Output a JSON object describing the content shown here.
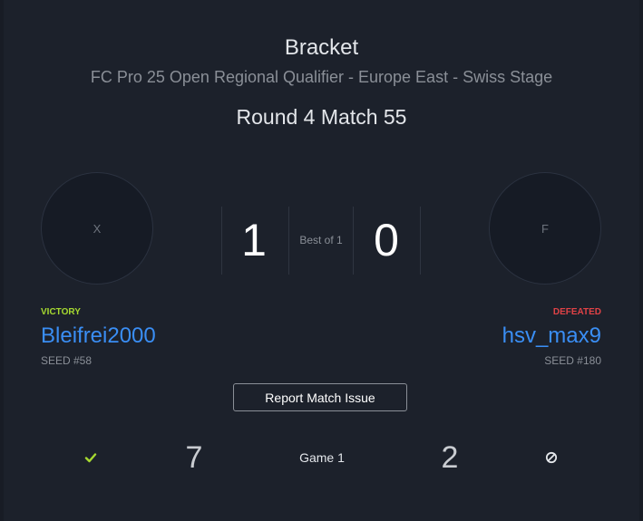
{
  "header": {
    "title": "Bracket",
    "subtitle": "FC Pro 25 Open Regional Qualifier - Europe East - Swiss Stage",
    "round": "Round 4 Match 55"
  },
  "match": {
    "best_of": "Best of 1",
    "player1": {
      "avatar_initial": "X",
      "score": "1",
      "status": "VICTORY",
      "name": "Bleifrei2000",
      "seed": "SEED #58"
    },
    "player2": {
      "avatar_initial": "F",
      "score": "0",
      "status": "DEFEATED",
      "name": "hsv_max9",
      "seed": "SEED #180"
    }
  },
  "report_button": "Report Match Issue",
  "games": [
    {
      "label": "Game 1",
      "score1": "7",
      "score2": "2",
      "icon1": "check-icon",
      "icon2": "ban-icon"
    }
  ],
  "colors": {
    "background": "#1c212b",
    "victory": "#a6d930",
    "defeated": "#e04246",
    "player_link": "#3a8ef4"
  }
}
